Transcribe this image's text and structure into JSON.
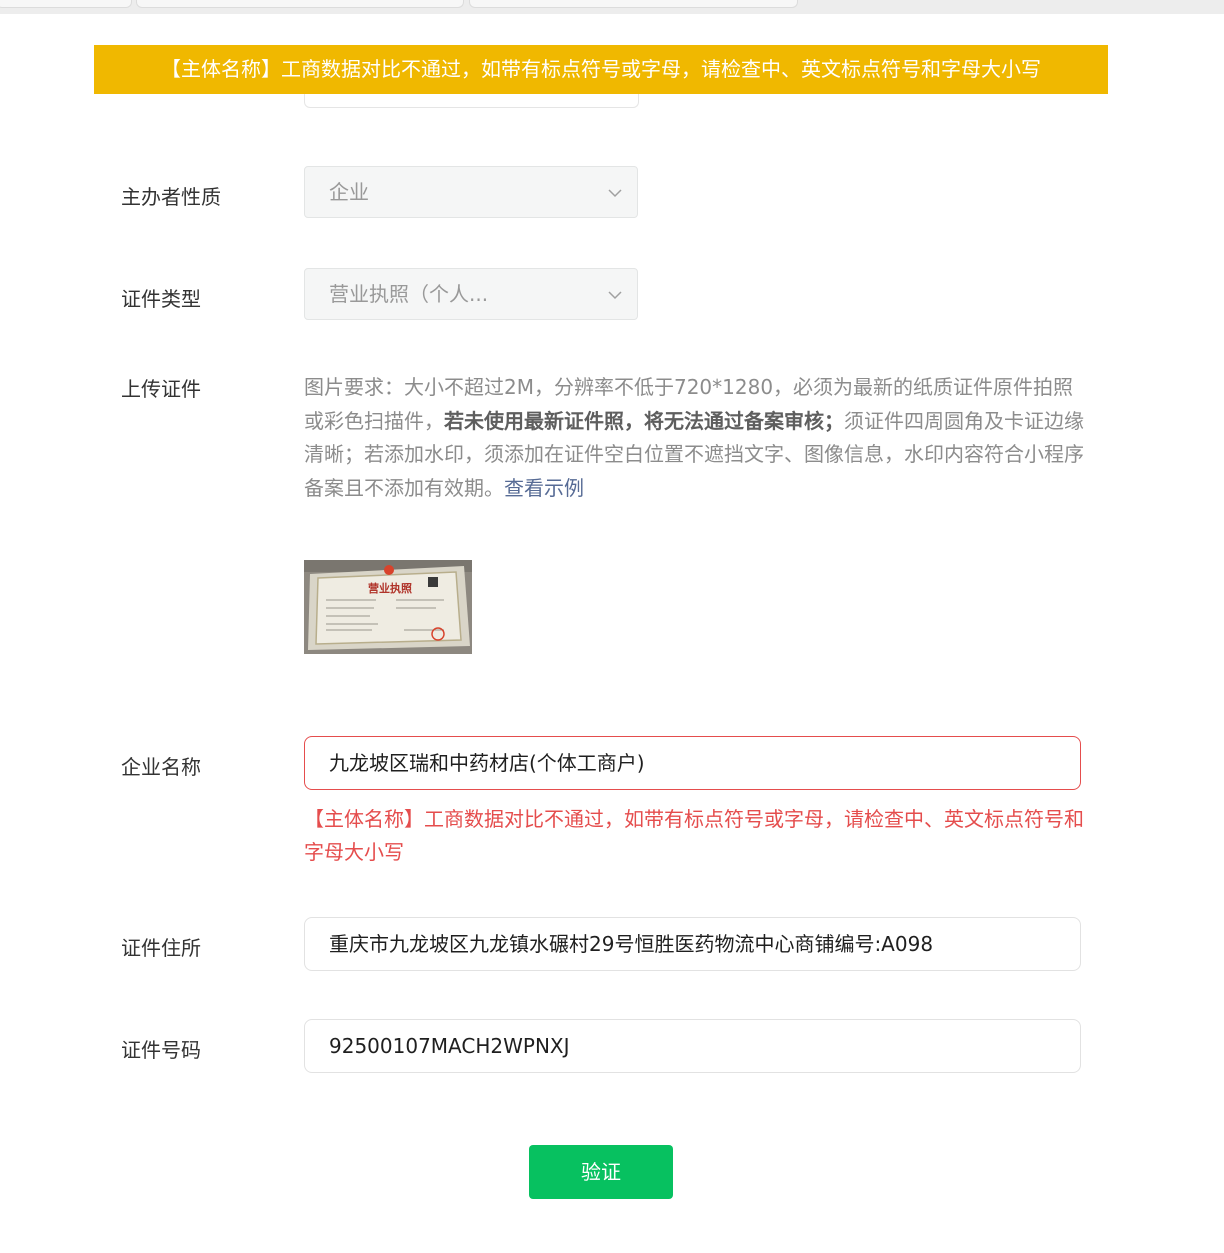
{
  "toast": {
    "text": "【主体名称】工商数据对比不通过，如带有标点符号或字母，请检查中、英文标点符号和字母大小写"
  },
  "form": {
    "organizer_type": {
      "label": "主办者性质",
      "value": "企业"
    },
    "cert_type": {
      "label": "证件类型",
      "value": "营业执照（个人..."
    },
    "upload": {
      "label": "上传证件",
      "req_prefix": "图片要求：大小不超过2M，分辨率不低于720*1280，必须为最新的纸质证件原件拍照或彩色扫描件，",
      "req_bold": "若未使用最新证件照，将无法通过备案审核；",
      "req_suffix": "须证件四周圆角及卡证边缘清晰；若添加水印，须添加在证件空白位置不遮挡文字、图像信息，水印内容符合小程序备案且不添加有效期。",
      "example_link": "查看示例",
      "thumb_title": "营业执照"
    },
    "company_name": {
      "label": "企业名称",
      "value": "九龙坡区瑞和中药材店(个体工商户)",
      "error": "【主体名称】工商数据对比不通过，如带有标点符号或字母，请检查中、英文标点符号和字母大小写"
    },
    "address": {
      "label": "证件住所",
      "value": "重庆市九龙坡区九龙镇水碾村29号恒胜医药物流中心商铺编号:A098"
    },
    "cert_number": {
      "label": "证件号码",
      "value": "92500107MACH2WPNXJ"
    }
  },
  "verify_button": {
    "label": "验证"
  },
  "colors": {
    "toast_bg": "#f0b800",
    "error": "#e54d4d",
    "primary": "#07c160",
    "link": "#576b95"
  }
}
